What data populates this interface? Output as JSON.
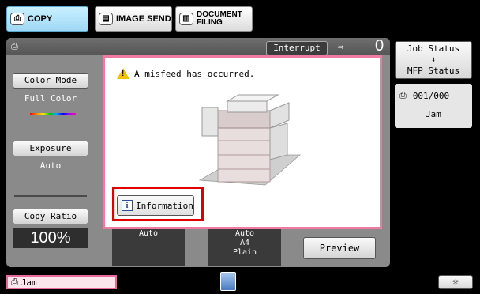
{
  "tabs": [
    {
      "label": "COPY",
      "icon": "copy-icon",
      "active": true
    },
    {
      "label": "IMAGE SEND",
      "icon": "image-send-icon",
      "active": false
    },
    {
      "label_line1": "DOCUMENT",
      "label_line2": "FILING",
      "icon": "document-filing-icon",
      "active": false
    }
  ],
  "header": {
    "interrupt_label": "Interrupt",
    "copy_count": "0"
  },
  "left_panel": {
    "color_mode_label": "Color Mode",
    "color_mode_value": "Full Color",
    "exposure_label": "Exposure",
    "exposure_value": "Auto",
    "copy_ratio_label": "Copy Ratio",
    "copy_ratio_value": "100%"
  },
  "settings": {
    "box1": "Auto",
    "box2_line1": "Auto",
    "box2_line2": "A4",
    "box2_line3": "Plain"
  },
  "preview_label": "Preview",
  "dialog": {
    "message": "A misfeed has occurred.",
    "info_button_label": "Information"
  },
  "status": {
    "job_status_label": "Job Status",
    "mfp_status_label": "MFP Status",
    "job_counter": "001/000",
    "job_state": "Jam"
  },
  "bottom": {
    "jam_label": "Jam"
  },
  "colors": {
    "highlight": "#e00000",
    "dialog_border": "#f07aa0",
    "active_tab": "#9fd8f5"
  }
}
